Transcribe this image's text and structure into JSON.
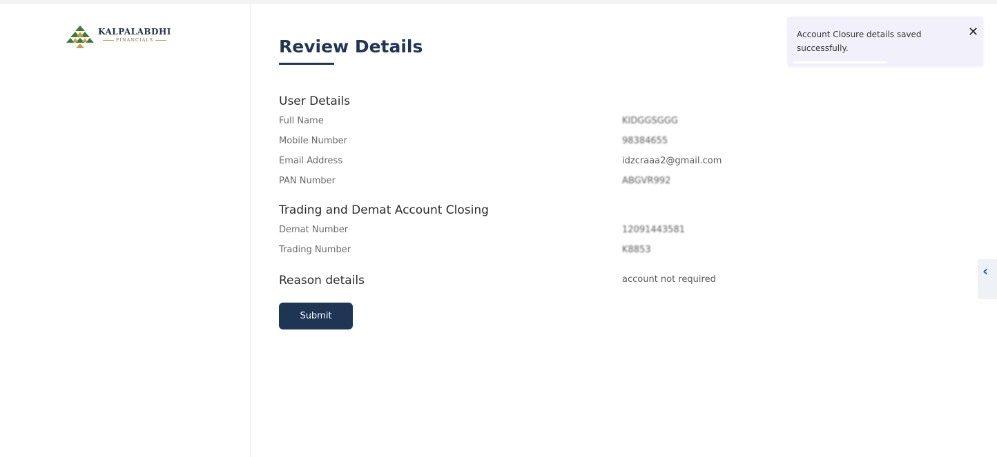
{
  "brand": {
    "name": "KALPALABDHI",
    "subtitle": "FINANCIALS",
    "logo_icon": "pyramid-tree-logo"
  },
  "page": {
    "title": "Review Details"
  },
  "sections": {
    "user_details": {
      "heading": "User Details",
      "fields": [
        {
          "label": "Full Name",
          "value": "KIDGGSGGG"
        },
        {
          "label": "Mobile Number",
          "value": "98384655"
        },
        {
          "label": "Email Address",
          "value": "idzcraaa2@gmail.com"
        },
        {
          "label": "PAN Number",
          "value": "ABGVR992"
        }
      ]
    },
    "account_closing": {
      "heading": "Trading and Demat Account Closing",
      "fields": [
        {
          "label": "Demat Number",
          "value": "12091443581"
        },
        {
          "label": "Trading Number",
          "value": "K8853"
        }
      ]
    },
    "reason": {
      "heading": "Reason details",
      "value": "account not required"
    }
  },
  "actions": {
    "submit_label": "Submit"
  },
  "toast": {
    "message": "Account Closure details saved successfully.",
    "close_symbol": "✕",
    "close_icon": "close-icon"
  },
  "side_tab": {
    "symbol": "‹",
    "icon": "chevron-left-icon"
  },
  "colors": {
    "primary": "#1f3554",
    "toast_bg": "#f2f0fa",
    "logo_green": "#3e7a3a",
    "logo_gold": "#c9a23a"
  }
}
